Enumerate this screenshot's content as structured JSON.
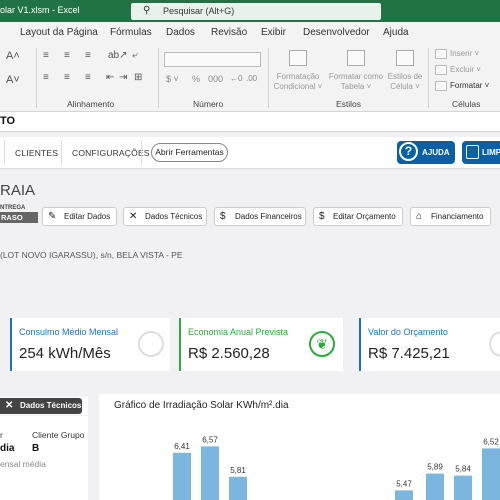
{
  "excel": {
    "title": "olar V1.xlsm  -  Excel",
    "search_placeholder": "Pesquisar (Alt+G)",
    "tabs": [
      "Layout da Página",
      "Fórmulas",
      "Dados",
      "Revisão",
      "Exibir",
      "Desenvolvedor",
      "Ajuda"
    ],
    "groups": [
      "Alinhamento",
      "Número",
      "Estilos",
      "Células"
    ],
    "styles": {
      "cond_format": [
        "Formatação",
        "Condicional ˅"
      ],
      "format_table": [
        "Formatar como",
        "Tabela ˅"
      ],
      "cell_styles": [
        "Estilos de",
        "Célula ˅"
      ]
    },
    "cells": {
      "insert": "Inserir ˅",
      "delete": "Excluir ˅",
      "format": "Formatar ˅"
    },
    "name_box": "TO"
  },
  "app": {
    "nav": {
      "clientes": "CLIENTES",
      "configuracoes": "CONFIGURAÇÕES",
      "abrir": "Abrir Ferramentas",
      "ajuda": "AJUDA",
      "limpar": "LIMPA"
    },
    "client_name": "RAIA",
    "entrega": "NTREGA",
    "status": "RASO",
    "actions": [
      {
        "icon": "✎",
        "label": "Editar Dados"
      },
      {
        "icon": "✕",
        "label": "Dados Técnicos"
      },
      {
        "icon": "$",
        "label": "Dados Financeiros"
      },
      {
        "icon": "$",
        "label": "Editar Orçamento"
      },
      {
        "icon": "⌂",
        "label": "Financiamento"
      }
    ],
    "address": "(LOT NOVO IGARASSU), s/n, BELA VISTA - PE",
    "cards": [
      {
        "title": "Consulmo Médio Mensal",
        "value": "254 kWh/Mês",
        "color": "#1a73c8"
      },
      {
        "title": "Economia Anual Prevista",
        "value": "R$ 2.560,28",
        "color": "#2eaa3c"
      },
      {
        "title": "Valor do Orçamento",
        "value": "R$ 7.425,21",
        "color": "#1a73c8"
      }
    ],
    "tech_button": "Dados Técnicos",
    "left_panel": {
      "col1_label": "r",
      "col1_value": "dia",
      "client_group_label": "Cliente Grupo",
      "client_group_value": "B",
      "cut_text": "ensal média"
    }
  },
  "chart_data": {
    "type": "bar",
    "title": "Gráfico de Irradiação Solar KWh/m².dia",
    "values": [
      6.41,
      6.57,
      5.81,
      5.47,
      5.89,
      5.84,
      6.52
    ],
    "value_labels": [
      "6,41",
      "6,57",
      "5,81",
      "5,47",
      "5,89",
      "5,84",
      "6,52"
    ],
    "bar_color": "#7ab6dd",
    "visible_in_view": "partial (bars cropped at bottom)"
  }
}
